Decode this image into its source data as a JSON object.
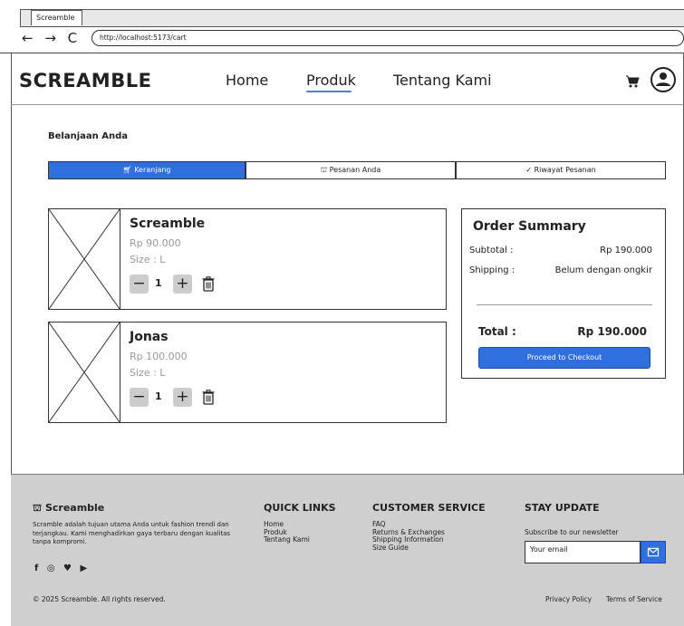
{
  "browser": {
    "tab_title": "Screamble",
    "nav_buttons": "← → C",
    "url": "http://localhost:5173/cart"
  },
  "header": {
    "logo": "SCREAMBLE",
    "nav": [
      {
        "label": "Home",
        "active": false
      },
      {
        "label": "Produk",
        "active": true
      },
      {
        "label": "Tentang Kami",
        "active": false
      }
    ],
    "icons": [
      "cart-icon",
      "user-icon"
    ]
  },
  "page": {
    "title": "Belanjaan Anda",
    "tabs": [
      {
        "label": "Keranjang",
        "icon": "cart-icon",
        "active": true
      },
      {
        "label": "Pesanan Anda",
        "icon": "bag-icon",
        "active": false
      },
      {
        "label": "Riwayat Pesanan",
        "icon": "check-circle-icon",
        "active": false
      }
    ]
  },
  "cart": {
    "items": [
      {
        "name": "Screamble",
        "price": "Rp 90.000",
        "size": "Size : L",
        "qty": "1"
      },
      {
        "name": "Jonas",
        "price": "Rp 100.000",
        "size": "Size : L",
        "qty": "1"
      }
    ],
    "minus_glyph": "−",
    "plus_glyph": "+"
  },
  "summary": {
    "title": "Order Summary",
    "subtotal_label": "Subtotal :",
    "subtotal_value": "Rp 190.000",
    "shipping_label": "Shipping :",
    "shipping_value": "Belum dengan ongkir",
    "total_label": "Total :",
    "total_value": "Rp 190.000",
    "checkout_label": "Proceed to Checkout"
  },
  "footer": {
    "brand": "Screamble",
    "description": "Scramble adalah tujuan utama Anda untuk fashion trendi dan terjangkau. Kami menghadirkan gaya terbaru dengan kualitas tanpa kompromi.",
    "social": "f ◎ ♥ ▶",
    "quick_links_title": "QUICK LINKS",
    "quick_links": [
      "Home",
      "Produk",
      "Tentang Kami"
    ],
    "customer_service_title": "CUSTOMER SERVICE",
    "customer_service": [
      "FAQ",
      "Returns & Exchanges",
      "Shipping Information",
      "Size Guide"
    ],
    "stay_update_title": "STAY UPDATE",
    "subscribe_text": "Subscribe to our newsletter",
    "email_placeholder": "Your email",
    "copyright": "© 2025 Screamble. All rights reserved.",
    "privacy": "Privacy Policy",
    "terms": "Terms of Service"
  },
  "colors": {
    "accent": "#2f6fde",
    "footer_bg": "#cfcfcf",
    "muted_text": "#999999"
  }
}
